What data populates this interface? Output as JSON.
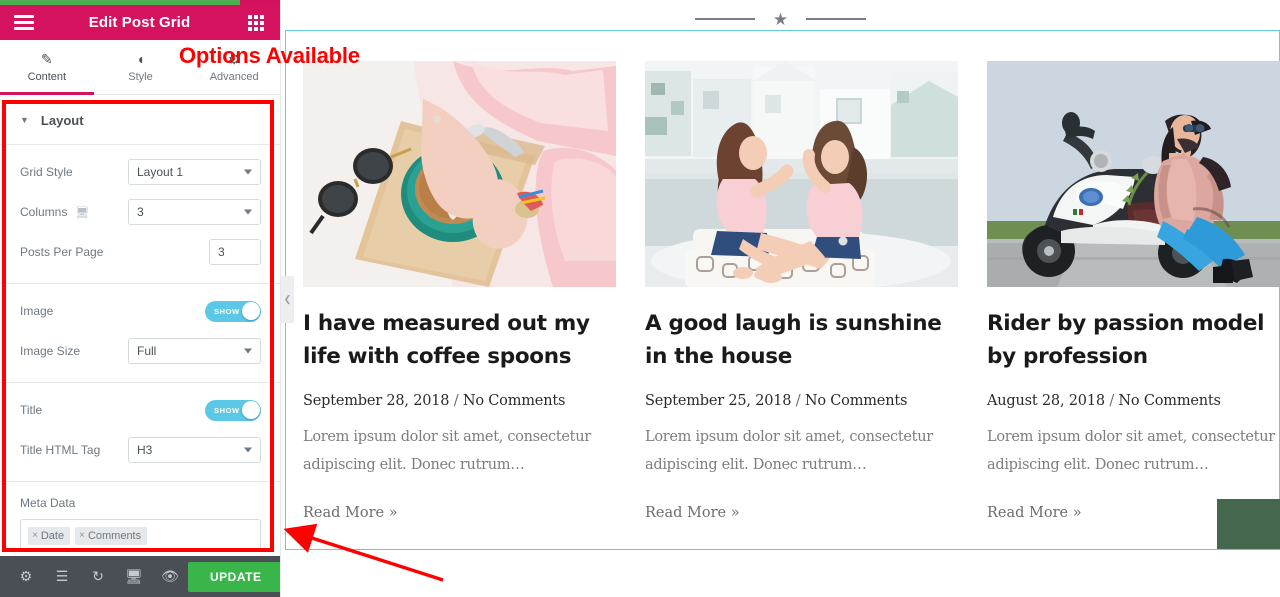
{
  "panel": {
    "header": {
      "title": "Edit Post Grid",
      "menu_icon": "hamburger-menu-icon",
      "apps_icon": "widgets-grid-icon",
      "bg_color": "#d5125e"
    },
    "tabs": [
      {
        "label": "Content",
        "icon": "pencil-icon",
        "active": true
      },
      {
        "label": "Style",
        "icon": "contrast-circle-icon",
        "active": false
      },
      {
        "label": "Advanced",
        "icon": "gear-icon",
        "active": false
      }
    ],
    "section": {
      "title": "Layout",
      "caret": "▼"
    },
    "controls": {
      "grid_style": {
        "label": "Grid Style",
        "value": "Layout 1"
      },
      "columns": {
        "label": "Columns",
        "value": "3",
        "device_icon": "desktop-icon"
      },
      "posts_per_page": {
        "label": "Posts Per Page",
        "value": "3"
      },
      "image": {
        "label": "Image",
        "toggle": "SHOW",
        "on": true
      },
      "image_size": {
        "label": "Image Size",
        "value": "Full"
      },
      "title": {
        "label": "Title",
        "toggle": "SHOW",
        "on": true
      },
      "title_html_tag": {
        "label": "Title HTML Tag",
        "value": "H3"
      },
      "meta_data": {
        "label": "Meta Data",
        "tags": [
          {
            "remove": "×",
            "label": "Date"
          },
          {
            "remove": "×",
            "label": "Comments"
          }
        ]
      }
    },
    "footer": {
      "icons": [
        "settings-gear-icon",
        "layers-navigator-icon",
        "history-icon",
        "responsive-mode-icon",
        "preview-eye-icon"
      ],
      "update_label": "UPDATE",
      "update_caret": "▲",
      "update_color": "#39b54a"
    },
    "collapse_handle": "❮"
  },
  "canvas": {
    "divider": {
      "star": "★"
    },
    "selection_color": "#62c9ee",
    "posts": [
      {
        "image": "woman-holding-latte-coffee-cup",
        "title": "I have measured out my life with coffee spoons",
        "date": "September 28, 2018",
        "separator": "/",
        "comments": "No Comments",
        "excerpt": "Lorem ipsum dolor sit amet, consectetur adipiscing elit. Donec rutrum…",
        "read_more": "Read More »"
      },
      {
        "image": "two-friends-sitting-on-rooftop",
        "title": "A good laugh is sunshine in the house",
        "date": "September 25, 2018",
        "separator": "/",
        "comments": "No Comments",
        "excerpt": "Lorem ipsum dolor sit amet, consectetur adipiscing elit. Donec rutrum…",
        "read_more": "Read More »"
      },
      {
        "image": "woman-leaning-on-white-scooter",
        "title": "Rider by passion model by profession",
        "date": "August 28, 2018",
        "separator": "/",
        "comments": "No Comments",
        "excerpt": "Lorem ipsum dolor sit amet, consectetur adipiscing elit. Donec rutrum…",
        "read_more": "Read More »"
      }
    ]
  },
  "annotation": {
    "text": "Options Available",
    "color": "#ff0000",
    "box_color": "#ff0000"
  }
}
